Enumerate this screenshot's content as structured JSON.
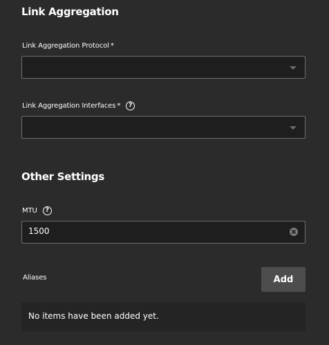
{
  "link_aggregation": {
    "title": "Link Aggregation",
    "protocol": {
      "label": "Link Aggregation Protocol",
      "required_mark": "*",
      "value": ""
    },
    "interfaces": {
      "label": "Link Aggregation Interfaces",
      "required_mark": "*",
      "help_glyph": "?",
      "value": ""
    }
  },
  "other_settings": {
    "title": "Other Settings",
    "mtu": {
      "label": "MTU",
      "help_glyph": "?",
      "value": "1500"
    },
    "aliases": {
      "label": "Aliases",
      "add_label": "Add",
      "empty_text": "No items have been added yet."
    }
  }
}
